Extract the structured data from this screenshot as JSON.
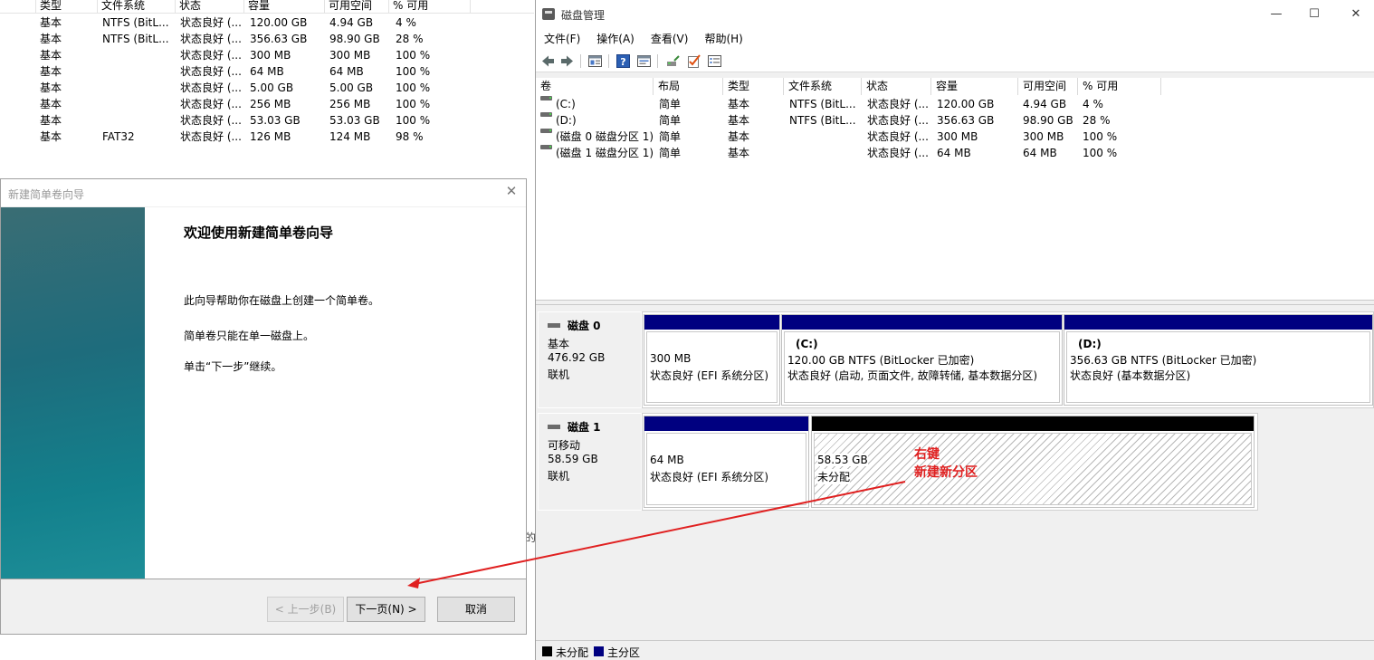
{
  "bg_list": {
    "columns": [
      "类型",
      "文件系统",
      "状态",
      "容量",
      "可用空间",
      "% 可用"
    ],
    "rows": [
      [
        "基本",
        "NTFS (BitL...",
        "状态良好 (...",
        "120.00 GB",
        "4.94 GB",
        "4 %"
      ],
      [
        "基本",
        "NTFS (BitL...",
        "状态良好 (...",
        "356.63 GB",
        "98.90 GB",
        "28 %"
      ],
      [
        "基本",
        "",
        "状态良好 (...",
        "300 MB",
        "300 MB",
        "100 %"
      ],
      [
        "基本",
        "",
        "状态良好 (...",
        "64 MB",
        "64 MB",
        "100 %"
      ],
      [
        "基本",
        "",
        "状态良好 (...",
        "5.00 GB",
        "5.00 GB",
        "100 %"
      ],
      [
        "基本",
        "",
        "状态良好 (...",
        "256 MB",
        "256 MB",
        "100 %"
      ],
      [
        "基本",
        "",
        "状态良好 (...",
        "53.03 GB",
        "53.03 GB",
        "100 %"
      ],
      [
        "基本",
        "FAT32",
        "状态良好 (...",
        "126 MB",
        "124 MB",
        "98 %"
      ]
    ],
    "fragment": "的"
  },
  "wizard": {
    "title": "新建简单卷向导",
    "close_glyph": "✕",
    "heading": "欢迎使用新建简单卷向导",
    "para1": "此向导帮助你在磁盘上创建一个简单卷。",
    "para2": "简单卷只能在单一磁盘上。",
    "para3": "单击“下一步”继续。",
    "back_label": "< 上一步(B)",
    "next_label": "下一页(N) >",
    "cancel_label": "取消"
  },
  "dm": {
    "title": "磁盘管理",
    "window_controls": [
      "—",
      "☐",
      "✕"
    ],
    "menu": [
      "文件(F)",
      "操作(A)",
      "查看(V)",
      "帮助(H)"
    ],
    "toolbar_icons": [
      "back-arrow-icon",
      "forward-arrow-icon",
      "disk-list-icon",
      "help-icon",
      "properties-icon",
      "connect-icon",
      "check-icon",
      "settings-icon"
    ],
    "columns": [
      "卷",
      "布局",
      "类型",
      "文件系统",
      "状态",
      "容量",
      "可用空间",
      "% 可用"
    ],
    "volumes": [
      [
        "(C:)",
        "简单",
        "基本",
        "NTFS (BitL...",
        "状态良好 (...",
        "120.00 GB",
        "4.94 GB",
        "4 %"
      ],
      [
        "(D:)",
        "简单",
        "基本",
        "NTFS (BitL...",
        "状态良好 (...",
        "356.63 GB",
        "98.90 GB",
        "28 %"
      ],
      [
        "(磁盘 0 磁盘分区 1)",
        "简单",
        "基本",
        "",
        "状态良好 (...",
        "300 MB",
        "300 MB",
        "100 %"
      ],
      [
        "(磁盘 1 磁盘分区 1)",
        "简单",
        "基本",
        "",
        "状态良好 (...",
        "64 MB",
        "64 MB",
        "100 %"
      ]
    ],
    "disks": [
      {
        "name": "磁盘 0",
        "type": "基本",
        "size": "476.92 GB",
        "status": "联机",
        "partitions": [
          {
            "label": "",
            "line1": "300 MB",
            "line2": "状态良好 (EFI 系统分区)",
            "kind": "primary"
          },
          {
            "label": "(C:)",
            "line1": "120.00 GB NTFS (BitLocker 已加密)",
            "line2": "状态良好 (启动, 页面文件, 故障转储, 基本数据分区)",
            "kind": "primary"
          },
          {
            "label": "(D:)",
            "line1": "356.63 GB NTFS (BitLocker 已加密)",
            "line2": "状态良好 (基本数据分区)",
            "kind": "primary"
          }
        ]
      },
      {
        "name": "磁盘 1",
        "type": "可移动",
        "size": "58.59 GB",
        "status": "联机",
        "partitions": [
          {
            "label": "",
            "line1": "64 MB",
            "line2": "状态良好 (EFI 系统分区)",
            "kind": "primary"
          },
          {
            "label": "",
            "line1": "58.53 GB",
            "line2": "未分配",
            "kind": "unallocated"
          }
        ]
      }
    ],
    "legend": {
      "unallocated": "未分配",
      "primary": "主分区"
    }
  },
  "annotation": {
    "line1": "右键",
    "line2": "新建新分区",
    "color": "#e02020"
  },
  "colors": {
    "primary_bar": "#000080",
    "unalloc_bar": "#000000",
    "wizard_banner": "#1e6c7c"
  }
}
